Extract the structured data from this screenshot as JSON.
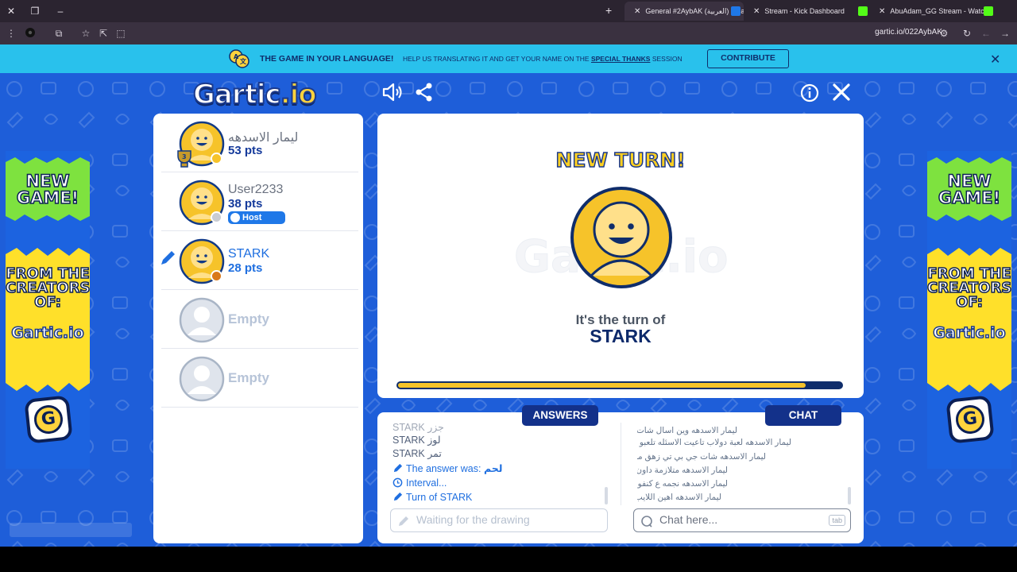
{
  "browser": {
    "tabs": [
      {
        "title": "General #2AybAK (العربية) - Ga"
      },
      {
        "title": "Stream - Kick Dashboard"
      },
      {
        "title": "AbuAdam_GG Stream - Watch"
      }
    ],
    "url": "gartic.io/022AybAK",
    "colors": {
      "kick_green": "#53fc18",
      "gartic_blue": "#1f78e8"
    }
  },
  "banner": {
    "headline": "THE GAME IN YOUR LANGUAGE!",
    "text": "HELP US TRANSLATING IT AND GET YOUR NAME ON THE",
    "link": "SPECIAL THANKS",
    "text_end": "SESSION",
    "button": "CONTRIBUTE"
  },
  "game": {
    "logo": "Gartic",
    "logo_suffix": ".io",
    "ad": {
      "line1": "NEW",
      "line2": "GAME!",
      "line3": "FROM THE",
      "line4": "CREATORS",
      "line5": "OF:",
      "brand": "Gartic.io",
      "badge": "G"
    },
    "players": [
      {
        "name": "ليمار الاسدهه",
        "points": "53 pts",
        "rank": "3",
        "status_color": "#f6c32a"
      },
      {
        "name": "User2233",
        "points": "38 pts",
        "badge": "Host",
        "status_color": "#c9ccd2"
      },
      {
        "name": "STARK",
        "points": "28 pts",
        "status_color": "#d9791a",
        "drawing": true
      },
      {
        "name": "Empty"
      },
      {
        "name": "Empty"
      }
    ],
    "board": {
      "heading": "NEW TURN!",
      "turn_label": "It's the turn of",
      "turn_player": "STARK",
      "progress": 0.92
    },
    "answers": {
      "tab": "ANSWERS",
      "lines": [
        {
          "user": "STARK",
          "text": "جزر"
        },
        {
          "user": "STARK",
          "text": "لوز"
        },
        {
          "user": "STARK",
          "text": "تمر"
        }
      ],
      "system": [
        {
          "icon": "pencil-icon",
          "text": "The answer was:",
          "value": "لحم"
        },
        {
          "icon": "clock-icon",
          "text": "Interval..."
        },
        {
          "icon": "pencil-icon",
          "text": "Turn of STARK"
        }
      ],
      "placeholder": "Waiting for the drawing"
    },
    "chat": {
      "tab": "CHAT",
      "lines": [
        "ليمار الاسدهه وين اسال شات جي بي تي",
        "ليمار الاسدهه لعبة دولاب تاعيت الاسئله تلعبو ها؟",
        "ليمار الاسدهه شات جي بي تي زهق مني",
        "ليمار الاسدهه متلازمة داون",
        "ليمار الاسدهه نجمه ع كنفوو",
        "ليمار الاسدهه اهين اللايب"
      ],
      "placeholder": "Chat here...",
      "key_hint": "tab"
    }
  }
}
